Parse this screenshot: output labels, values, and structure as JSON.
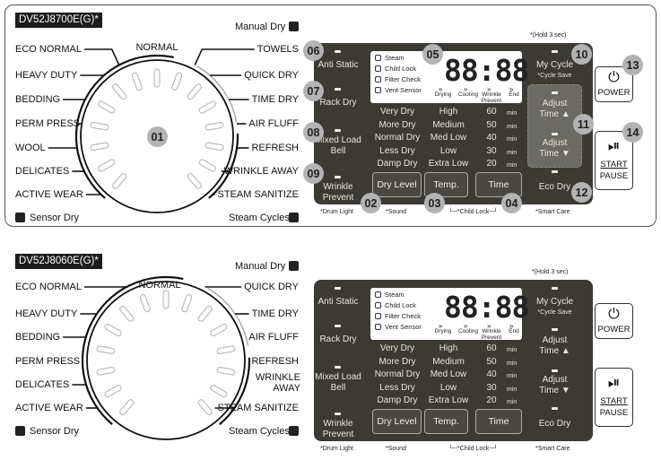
{
  "units": [
    {
      "model": "DV52J8700E(G)*",
      "manual_dry": "Manual Dry",
      "sensor_dry": "Sensor Dry",
      "steam_cycles": "Steam Cycles",
      "dial_top": "NORMAL",
      "left_cycles": [
        "ECO NORMAL",
        "HEAVY DUTY",
        "BEDDING",
        "PERM PRESS",
        "WOOL",
        "DELICATES",
        "ACTIVE WEAR"
      ],
      "right_cycles": [
        "TOWELS",
        "QUICK DRY",
        "TIME DRY",
        "AIR FLUFF",
        "REFRESH",
        "WRINKLE AWAY",
        "STEAM SANITIZE"
      ],
      "badges": {
        "dial": "01",
        "dry_level": "02",
        "temp": "03",
        "time": "04",
        "display": "05",
        "anti_static": "06",
        "rack_dry": "07",
        "mixed_load_bell": "08",
        "wrinkle_prevent": "09",
        "my_cycle": "10",
        "adjust_time": "11",
        "eco_dry": "12",
        "power": "13",
        "start_pause": "14"
      }
    },
    {
      "model": "DV52J8060E(G)*",
      "manual_dry": "Manual Dry",
      "sensor_dry": "Sensor Dry",
      "steam_cycles": "Steam Cycles",
      "dial_top": "NORMAL",
      "left_cycles": [
        "ECO NORMAL",
        "HEAVY DUTY",
        "BEDDING",
        "PERM PRESS",
        "DELICATES",
        "ACTIVE WEAR"
      ],
      "right_cycles": [
        "QUICK DRY",
        "TIME DRY",
        "AIR FLUFF",
        "REFRESH",
        "WRINKLE AWAY",
        "STEAM SANITIZE"
      ]
    }
  ],
  "panel": {
    "hold": "*(Hold 3 sec)",
    "left_buttons": [
      "Anti Static",
      "Rack Dry",
      "Mixed Load Bell",
      "Wrinkle Prevent"
    ],
    "indicators": [
      "Steam",
      "Child Lock",
      "Filter Check",
      "Vent Sensor"
    ],
    "digits": "88:88",
    "progress": [
      "Drying",
      "Cooling",
      "Wrinkle Prevent",
      "End"
    ],
    "dry_levels": [
      "Very Dry",
      "More Dry",
      "Normal Dry",
      "Less Dry",
      "Damp Dry"
    ],
    "temps": [
      "High",
      "Medium",
      "Med Low",
      "Low",
      "Extra Low"
    ],
    "times": [
      "60",
      "50",
      "40",
      "30",
      "20"
    ],
    "time_unit": "min",
    "buttons": [
      "Dry Level",
      "Temp.",
      "Time"
    ],
    "my_cycle": "My Cycle",
    "cycle_save": "*Cycle Save",
    "adjust_up": "Adjust Time ▲",
    "adjust_down": "Adjust Time ▼",
    "eco_dry": "Eco Dry",
    "footnotes": [
      "*Drum Light",
      "*Sound",
      "└─*Child Lock─┘",
      "*Smart Care"
    ],
    "power": "POWER",
    "start": "START",
    "pause": "PAUSE"
  },
  "colors": {
    "panel": "#3c3a33",
    "badge": "#b3b3b3",
    "highlight": "#6b6a64"
  }
}
